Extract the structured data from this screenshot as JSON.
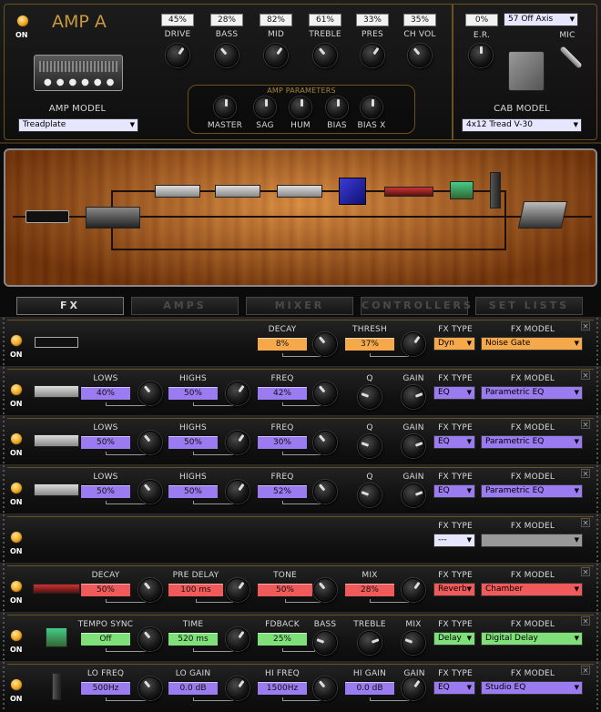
{
  "amp": {
    "name": "AMP A",
    "power_label": "ON",
    "amp_model_label": "AMP MODEL",
    "amp_model_value": "Treadplate",
    "knobs": [
      {
        "label": "DRIVE",
        "value": "45%"
      },
      {
        "label": "BASS",
        "value": "28%"
      },
      {
        "label": "MID",
        "value": "82%"
      },
      {
        "label": "TREBLE",
        "value": "61%"
      },
      {
        "label": "PRES",
        "value": "33%"
      },
      {
        "label": "CH VOL",
        "value": "35%"
      }
    ],
    "params_title": "AMP PARAMETERS",
    "params": [
      "MASTER",
      "SAG",
      "HUM",
      "BIAS",
      "BIAS X"
    ],
    "er_label": "E.R.",
    "er_value": "0%",
    "mic_label": "MIC",
    "mic_value": "57 Off Axis",
    "cab_model_label": "CAB MODEL",
    "cab_model_value": "4x12 Tread V-30"
  },
  "tabs": [
    "FX",
    "AMPS",
    "MIXER",
    "CONTROLLERS",
    "SET LISTS"
  ],
  "colors": {
    "orange": "#f5a94a",
    "purple": "#9a7bf0",
    "red": "#f05a5a",
    "green": "#7fe07a",
    "gold": "#6b5020"
  },
  "fx_type_label": "FX TYPE",
  "fx_model_label": "FX MODEL",
  "on_label": "ON",
  "rows": [
    {
      "params": [
        {
          "label": "DECAY",
          "value": "8%"
        },
        {
          "label": "THRESH",
          "value": "37%"
        }
      ],
      "fx_type": "Dyn",
      "fx_model": "Noise Gate"
    },
    {
      "params": [
        {
          "label": "LOWS",
          "value": "40%"
        },
        {
          "label": "HIGHS",
          "value": "50%"
        },
        {
          "label": "FREQ",
          "value": "42%"
        }
      ],
      "knobs": [
        "Q",
        "GAIN"
      ],
      "fx_type": "EQ",
      "fx_model": "Parametric EQ"
    },
    {
      "params": [
        {
          "label": "LOWS",
          "value": "50%"
        },
        {
          "label": "HIGHS",
          "value": "50%"
        },
        {
          "label": "FREQ",
          "value": "30%"
        }
      ],
      "knobs": [
        "Q",
        "GAIN"
      ],
      "fx_type": "EQ",
      "fx_model": "Parametric EQ"
    },
    {
      "params": [
        {
          "label": "LOWS",
          "value": "50%"
        },
        {
          "label": "HIGHS",
          "value": "50%"
        },
        {
          "label": "FREQ",
          "value": "52%"
        }
      ],
      "knobs": [
        "Q",
        "GAIN"
      ],
      "fx_type": "EQ",
      "fx_model": "Parametric EQ"
    },
    {
      "params": [],
      "fx_type": "---",
      "fx_model": ""
    },
    {
      "params": [
        {
          "label": "DECAY",
          "value": "50%"
        },
        {
          "label": "PRE DELAY",
          "value": "100 ms"
        },
        {
          "label": "TONE",
          "value": "50%"
        },
        {
          "label": "MIX",
          "value": "28%"
        }
      ],
      "fx_type": "Reverb",
      "fx_model": "Chamber"
    },
    {
      "params": [
        {
          "label": "TEMPO SYNC",
          "value": "Off"
        },
        {
          "label": "TIME",
          "value": "520 ms"
        },
        {
          "label": "FDBACK",
          "value": "25%"
        }
      ],
      "knobs": [
        "BASS",
        "TREBLE",
        "MIX"
      ],
      "fx_type": "Delay",
      "fx_model": "Digital Delay"
    },
    {
      "params": [
        {
          "label": "LO FREQ",
          "value": "500Hz"
        },
        {
          "label": "LO GAIN",
          "value": "0.0 dB"
        },
        {
          "label": "HI FREQ",
          "value": "1500Hz"
        },
        {
          "label": "HI GAIN",
          "value": "0.0 dB"
        }
      ],
      "knobs": [
        "GAIN"
      ],
      "fx_type": "EQ",
      "fx_model": "Studio EQ"
    }
  ]
}
